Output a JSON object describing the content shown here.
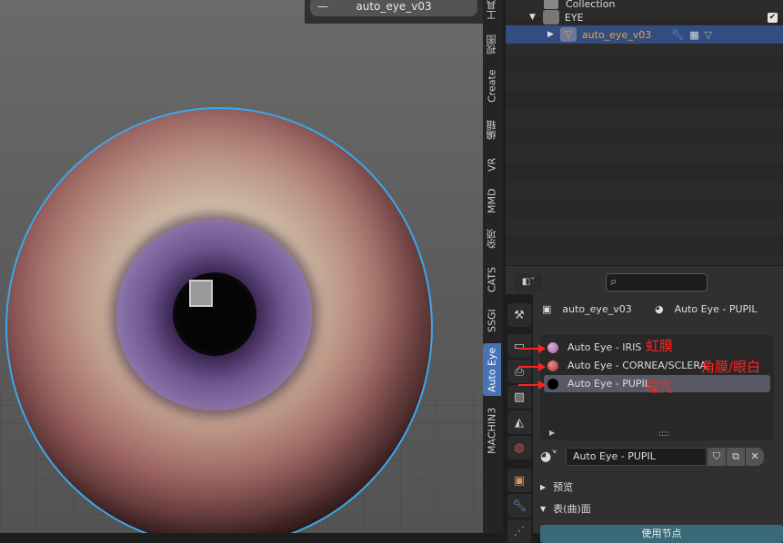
{
  "viewport": {
    "object_name": "auto_eye_v03",
    "collapse_icon": "minus-icon",
    "selection_outline_color": "#39a8ea"
  },
  "side_tabs": [
    "工具",
    "视图",
    "Create",
    "编辑",
    "VR",
    "MMD",
    "杂项",
    "CATS",
    "SSGI",
    "Auto Eye",
    "MACHIN3"
  ],
  "active_side_tab": "Auto Eye",
  "outliner": {
    "rows": [
      {
        "label": "Collection",
        "icon": "collection-icon"
      },
      {
        "label": "EYE",
        "icon": "collection-icon",
        "checked": true
      },
      {
        "label": "auto_eye_v03",
        "icon": "mesh-icon",
        "selected": true,
        "modifiers": [
          "wrench-icon",
          "particles-icon",
          "vertex-group-icon"
        ]
      }
    ]
  },
  "properties": {
    "search_placeholder": "",
    "object_name": "auto_eye_v03",
    "material_name": "Auto Eye - PUPIL",
    "materials": [
      {
        "name": "Auto Eye - IRIS",
        "color": "#b77fb0",
        "note": "虹膜"
      },
      {
        "name": "Auto Eye - CORNEA/SCLERA",
        "color": "#c24b4f",
        "note": "角膜/眼白"
      },
      {
        "name": "Auto Eye - PUPIL",
        "color": "#000000",
        "note": "瞳孔",
        "selected": true
      }
    ],
    "list_handle": "::::",
    "slot_field": "Auto Eye - PUPIL",
    "sections": [
      "预览",
      "表(曲)面"
    ],
    "use_nodes": "使用节点",
    "annotation_color": "#ff2222"
  }
}
